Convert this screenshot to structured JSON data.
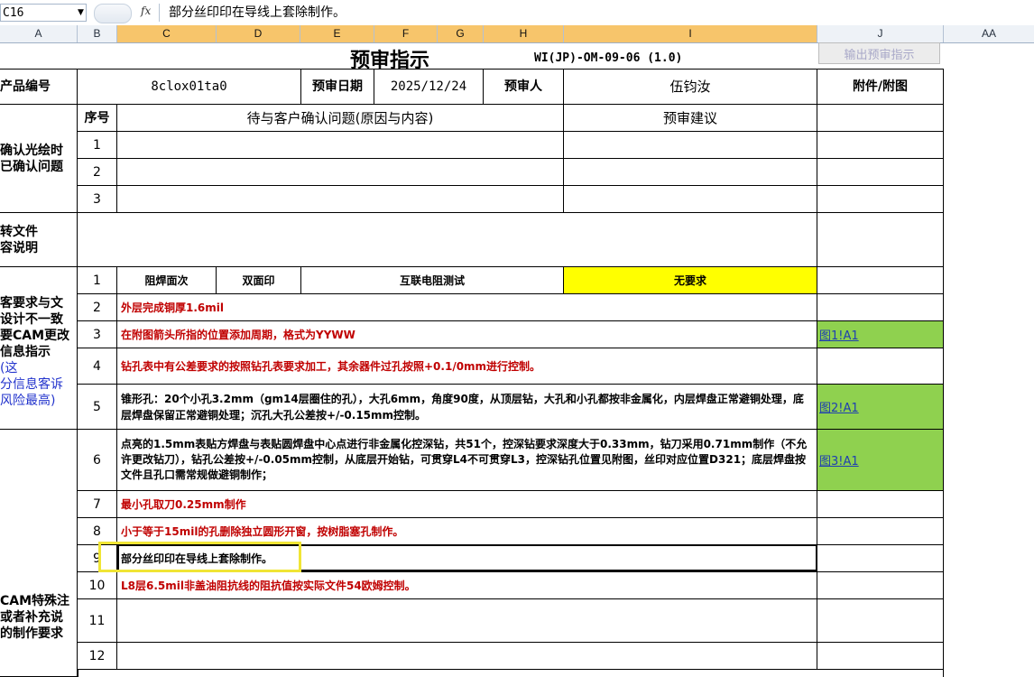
{
  "formula_bar": {
    "cell_ref": "C16",
    "fx_label": "fx",
    "content": "部分丝印印在导线上套除制作。"
  },
  "columns": [
    "A",
    "B",
    "C",
    "D",
    "E",
    "F",
    "G",
    "H",
    "I",
    "J",
    "AA"
  ],
  "header": {
    "title": "预审指示",
    "doc_no": "WI(JP)-OM-09-06 (1.0)",
    "export_button": "输出预审指示"
  },
  "info_row": {
    "product_label": "产品编号",
    "product_value": "8clox01ta0",
    "date_label": "预审日期",
    "date_value": "2025/12/24",
    "reviewer_label": "预审人",
    "reviewer_value": "伍钧汝",
    "attachment_label": "附件/附图"
  },
  "section1": {
    "label": "确认光绘时\n已确认问题",
    "no_header": "序号",
    "issue_header": "待与客户确认问题(原因与内容)",
    "suggest_header": "预审建议",
    "rows": [
      "1",
      "2",
      "3"
    ]
  },
  "section2": {
    "label": "转文件\n容说明"
  },
  "section3": {
    "label_part1": "客要求与文\n设计不一致\n要CAM更改\n信息指示",
    "label_part2": "(这\n分信息客诉\n风险最高)",
    "row1": {
      "no": "1",
      "c1": "阻焊面次",
      "c2": "双面印",
      "c3": "互联电阻测试",
      "c4": "无要求"
    },
    "row2": {
      "no": "2",
      "text": "外层完成铜厚1.6mil"
    },
    "row3": {
      "no": "3",
      "text": "在附图箭头所指的位置添加周期，格式为YYWW",
      "link": "图1!A1"
    },
    "row4": {
      "no": "4",
      "text": "钻孔表中有公差要求的按照钻孔表要求加工，其余器件过孔按照+0.1/0mm进行控制。"
    },
    "row5": {
      "no": "5",
      "text": "锥形孔：20个小孔3.2mm（gm14层圈住的孔），大孔6mm，角度90度，从顶层钻，大孔和小孔都按非金属化，内层焊盘正常避铜处理，底层焊盘保留正常避铜处理；沉孔大孔公差按+/-0.15mm控制。",
      "link": "图2!A1"
    }
  },
  "section4": {
    "label": "CAM特殊注\n或者补充说\n的制作要求",
    "row6": {
      "no": "6",
      "text": "点亮的1.5mm表贴方焊盘与表贴圆焊盘中心点进行非金属化控深钻，共51个，控深钻要求深度大于0.33mm，钻刀采用0.71mm制作（不允许更改钻刀），钻孔公差按+/-0.05mm控制，从底层开始钻，可贯穿L4不可贯穿L3，控深钻孔位置见附图，丝印对应位置D321；底层焊盘按文件且孔口需常规做避铜制作；",
      "link": "图3!A1"
    },
    "row7": {
      "no": "7",
      "text": "最小孔取刀0.25mm制作"
    },
    "row8": {
      "no": "8",
      "text": "小于等于15mil的孔删除独立圆形开窗，按树脂塞孔制作。"
    },
    "row9": {
      "no": "9",
      "text": "部分丝印印在导线上套除制作。"
    },
    "row10": {
      "no": "10",
      "text": "L8层6.5mil非盖油阻抗线的阻抗值按实际文件54欧姆控制。"
    },
    "row11": {
      "no": "11"
    },
    "row12": {
      "no": "12"
    }
  }
}
